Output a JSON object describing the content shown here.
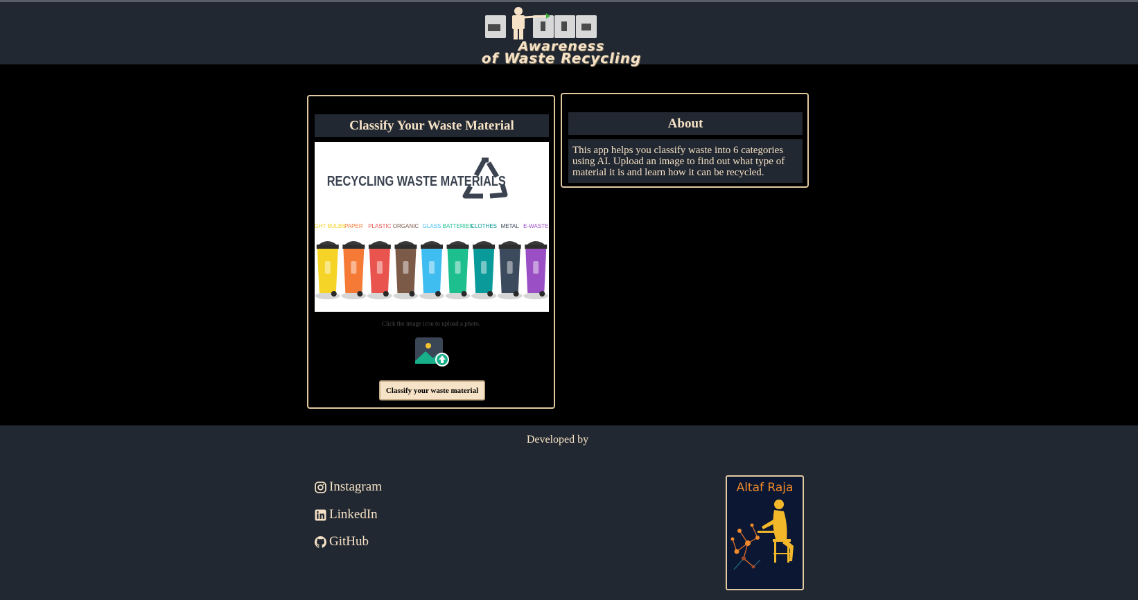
{
  "header": {
    "logo_line1": "Awareness",
    "logo_line2": "of Waste Recycling"
  },
  "classify_card": {
    "title": "Classify Your Waste Material",
    "image": {
      "heading": "RECYCLING  WASTE MATERIALS",
      "bins": [
        {
          "label": "LIGHT BULBS",
          "color": "#f5d327"
        },
        {
          "label": "PAPER",
          "color": "#f47a35"
        },
        {
          "label": "PLASTIC",
          "color": "#e9544e"
        },
        {
          "label": "ORGANIC",
          "color": "#7c5a48"
        },
        {
          "label": "GLASS",
          "color": "#3fbdf0"
        },
        {
          "label": "BATTERIES",
          "color": "#1ebf8f"
        },
        {
          "label": "CLOTHES",
          "color": "#0a9a9a"
        },
        {
          "label": "METAL",
          "color": "#3b4a5c"
        },
        {
          "label": "E-WASTE",
          "color": "#9b4fc4"
        }
      ]
    },
    "hint": "Click the image icon to upload a photo.",
    "upload_icon": "image-upload-icon",
    "button_label": "Classify your waste material"
  },
  "about_card": {
    "title": "About",
    "text": "This app helps you classify waste into 6 categories using AI. Upload an image to find out what type of material it is and learn how it can be recycled."
  },
  "footer": {
    "developed_by": "Developed by",
    "links": [
      {
        "label": "Instagram",
        "icon": "instagram-icon"
      },
      {
        "label": "LinkedIn",
        "icon": "linkedin-icon"
      },
      {
        "label": "GitHub",
        "icon": "github-icon"
      }
    ],
    "profile_name": "Altaf Raja"
  },
  "colors": {
    "accent": "#f6e2c6",
    "panel": "#222831",
    "background": "#000000",
    "border": "#e2c9a1"
  }
}
